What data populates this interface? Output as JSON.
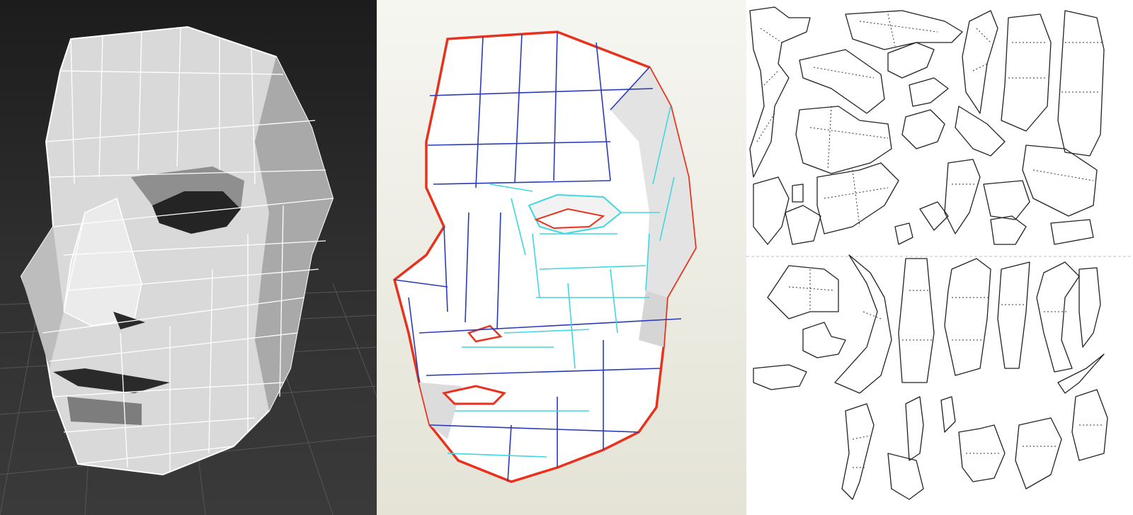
{
  "image": {
    "panels": [
      {
        "id": "viewport-3d",
        "kind": "3d-wireframe-render",
        "background": "#1f1f1f",
        "mesh_fill": "#d8d8d8",
        "edge_color": "#ffffff"
      },
      {
        "id": "unfold-preview",
        "kind": "papercraft-fold-preview",
        "background": "#efeee6",
        "cut_edge_color": "#e8321e",
        "mountain_fold_color": "#2a3bb8",
        "valley_fold_color": "#3fd8e0"
      },
      {
        "id": "pattern-sheets",
        "kind": "papercraft-printable-pattern",
        "background": "#ffffff",
        "outline_color": "#222222",
        "fold_line_style": "dotted",
        "page_count": 2
      }
    ],
    "icons": [
      "face-mask-mesh-icon",
      "papercraft-face-icon",
      "pattern-pieces-icon"
    ]
  }
}
